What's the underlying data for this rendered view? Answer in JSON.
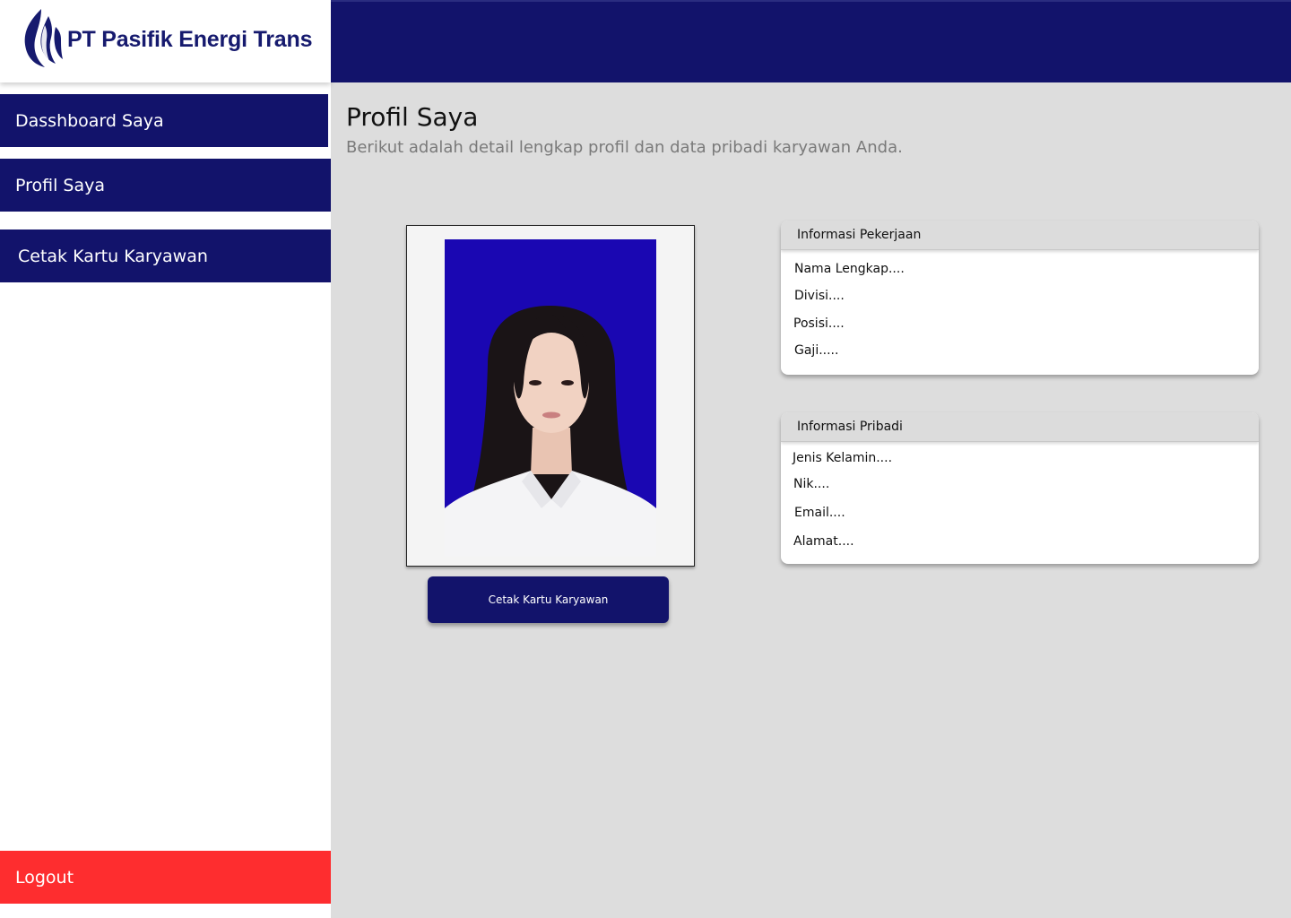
{
  "brand": {
    "name": "PT Pasifik Energi Trans",
    "color": "#161a6e"
  },
  "sidebar": {
    "items": [
      {
        "label": "Dasshboard Saya"
      },
      {
        "label": "Profil Saya"
      },
      {
        "label": "Cetak Kartu Karyawan"
      }
    ],
    "logout_label": "Logout"
  },
  "page": {
    "title": "Profil Saya",
    "subtitle": "Berikut adalah detail lengkap profil dan data pribadi karyawan Anda."
  },
  "profile": {
    "print_button_label": "Cetak Kartu Karyawan"
  },
  "job_info": {
    "title": "Informasi Pekerjaan",
    "fields": [
      "Nama Lengkap....",
      "Divisi....",
      "Posisi....",
      "Gaji....."
    ]
  },
  "personal_info": {
    "title": "Informasi Pribadi",
    "fields": [
      "Jenis Kelamin....",
      "Nik....",
      "Email....",
      "Alamat...."
    ]
  },
  "colors": {
    "primary": "#12136b",
    "logout": "#fe2d2f",
    "background": "#dddddd",
    "photo_background": "#1a07b2"
  }
}
